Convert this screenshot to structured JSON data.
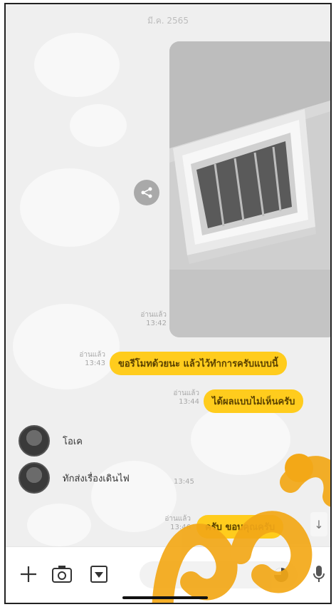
{
  "chat": {
    "date_label": "มี.ค. 2565",
    "photo": {
      "meta_time": "13:42",
      "meta_read": "อ่านแล้ว"
    },
    "messages_out": [
      {
        "text": "ขอรีโมทด้วยนะ แล้วไว้ทำการครับแบบนี้",
        "meta_read": "อ่านแล้ว",
        "meta_time": "13:43"
      },
      {
        "text": "ได้ผลแบบไม่เห็นครับ",
        "meta_read": "อ่านแล้ว",
        "meta_time": "13:44"
      },
      {
        "text": "ครับ ขอบคุณครับ",
        "meta_read": "อ่านแล้ว",
        "meta_time": "13:46"
      }
    ],
    "messages_in": [
      {
        "text": "โอเค",
        "meta_time": "13:45"
      },
      {
        "text": "ทักส่งเรื่องเดินไฟ",
        "meta_time": "13:45"
      }
    ]
  },
  "colors": {
    "bubble_out": "#ffcc1d",
    "background": "#efefef",
    "watermark": "#f3a817"
  },
  "input_bar": {
    "icons": [
      "plus-icon",
      "camera-icon",
      "image-icon",
      "sticker-icon",
      "mic-icon"
    ]
  }
}
